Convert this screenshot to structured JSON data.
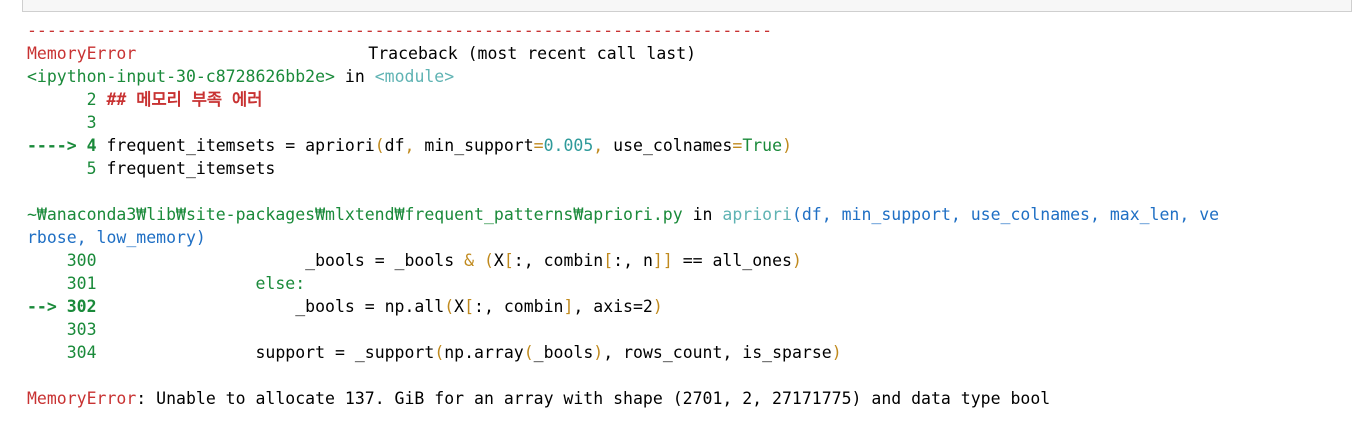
{
  "traceback": {
    "separator": "---------------------------------------------------------------------------",
    "error_name": "MemoryError",
    "header_right": "Traceback (most recent call last)",
    "frame1": {
      "file": "<ipython-input-30-c8728626bb2e>",
      "in_word": " in ",
      "func": "<module>",
      "l2_num": "      2",
      "l2_code": " ## 메모리 부족 에러",
      "l3_num": "      3",
      "l4_arrow": "----> 4",
      "l4_name": " frequent_itemsets = apriori",
      "l4_paren_open": "(",
      "l4_df": "df",
      "l4_comma1": ", ",
      "l4_ms": "min_support",
      "l4_eq1": "=",
      "l4_val1": "0.005",
      "l4_comma2": ", ",
      "l4_uc": "use_colnames",
      "l4_eq2": "=",
      "l4_val2": "True",
      "l4_paren_close": ")",
      "l5_num": "      5",
      "l5_code": " frequent_itemsets"
    },
    "frame2": {
      "file": "~₩anaconda3₩lib₩site-packages₩mlxtend₩frequent_patterns₩apriori.py",
      "in_word": " in ",
      "func": "apriori",
      "args_line1": "(df, min_support, use_colnames, max_len, ve",
      "args_line2": "rbose, low_memory)",
      "l300_num": "    300",
      "l300_a": "                     _bools = _bools ",
      "l300_amp": "&",
      "l300_b": " ",
      "l300_p1": "(",
      "l300_c": "X",
      "l300_br1": "[",
      "l300_d": ":, combin",
      "l300_br2": "[",
      "l300_e": ":, n",
      "l300_br3": "]]",
      "l300_f": " == all_ones",
      "l300_p2": ")",
      "l301_num": "    301",
      "l301_code": "                else:",
      "l302_arrow": "--> 302",
      "l302_a": "                    _bools = np.all",
      "l302_p1": "(",
      "l302_b": "X",
      "l302_br1": "[",
      "l302_c": ":, combin",
      "l302_br2": "]",
      "l302_d": ", axis=2",
      "l302_p2": ")",
      "l303_num": "    303",
      "l304_num": "    304",
      "l304_a": "                support = _support",
      "l304_p1": "(",
      "l304_b": "np.array",
      "l304_p2": "(",
      "l304_c": "_bools",
      "l304_p3": ")",
      "l304_d": ", rows_count, is_sparse",
      "l304_p4": ")"
    },
    "final": {
      "name": "MemoryError",
      "message": ": Unable to allocate 137. GiB for an array with shape (2701, 2, 27171775) and data type bool"
    }
  }
}
